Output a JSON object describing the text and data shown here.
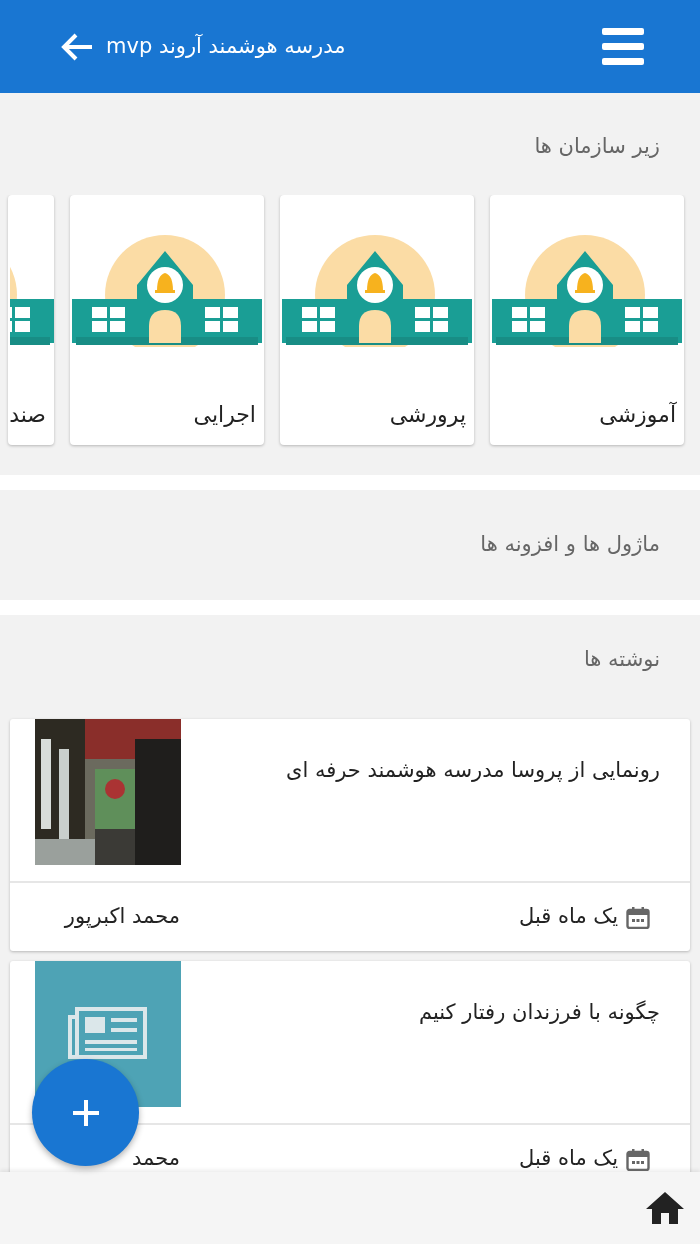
{
  "app_bar": {
    "title": "مدرسه هوشمند آروند mvp"
  },
  "sub_organizations": {
    "heading": "زیر سازمان ها",
    "items": [
      {
        "label": "آموزشی"
      },
      {
        "label": "پرورشی"
      },
      {
        "label": "اجرایی"
      },
      {
        "label": "صند"
      }
    ]
  },
  "modules": {
    "heading": "ماژول ها و افزونه ها"
  },
  "posts": {
    "heading": "نوشته ها",
    "items": [
      {
        "title": "رونمایی از پروسا مدرسه هوشمند حرفه ای",
        "kind": "picture",
        "date": "یک ماه قبل",
        "author": "محمد اکبرپور"
      },
      {
        "title": "چگونه با فرزندان رفتار کنیم",
        "kind": "newspaper",
        "date": "یک ماه قبل",
        "author": "محمد"
      }
    ]
  }
}
